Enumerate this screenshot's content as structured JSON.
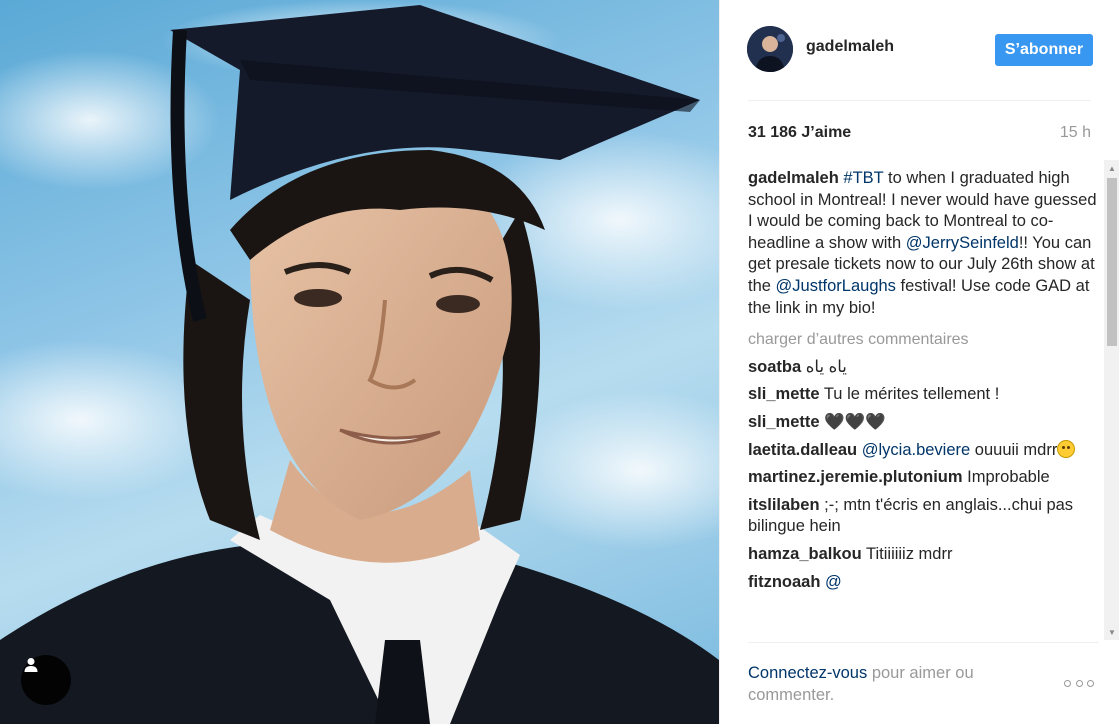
{
  "post": {
    "username": "gadelmaleh",
    "follow_label": "S’abonner",
    "likes": "31 186 J’aime",
    "timestamp": "15 h"
  },
  "caption": {
    "author": "gadelmaleh",
    "hashtag": "#TBT",
    "text1": " to when I graduated high school in Montreal! I never would have guessed I would be coming back to Montreal to co-headline a show with ",
    "mention1": "@JerrySeinfeld",
    "text2": "!! You can get presale tickets now to our July 26th show at the ",
    "mention2": "@JustforLaughs",
    "text3": " festival! Use code GAD at the link in my bio!"
  },
  "load_more": "charger d’autres commentaires",
  "comments": [
    {
      "author": "soatba",
      "text": "ياه ياه"
    },
    {
      "author": "sli_mette",
      "text": "Tu le mérites tellement !"
    },
    {
      "author": "sli_mette",
      "text": "🖤🖤🖤"
    },
    {
      "author": "laetita.dalleau",
      "mention": "@lycia.beviere",
      "text": " ouuuii mdrr"
    },
    {
      "author": "martinez.jeremie.plutonium",
      "text": "Improbable"
    },
    {
      "author": "itslilaben",
      "text": ";-; mtn t'écris en anglais...chui pas bilingue hein"
    },
    {
      "author": "hamza_balkou",
      "text": "Titiiiiiiz mdrr"
    },
    {
      "author": "fitznoaah",
      "text": "@"
    }
  ],
  "footer": {
    "login_link": "Connectez-vous",
    "login_text": " pour aimer ou commenter."
  },
  "icons": {
    "user_tag": "person-icon",
    "more": "ellipsis-icon",
    "avatar": "profile-photo"
  },
  "colors": {
    "follow_button": "#3897f0",
    "link": "#003569",
    "muted": "#999999"
  }
}
